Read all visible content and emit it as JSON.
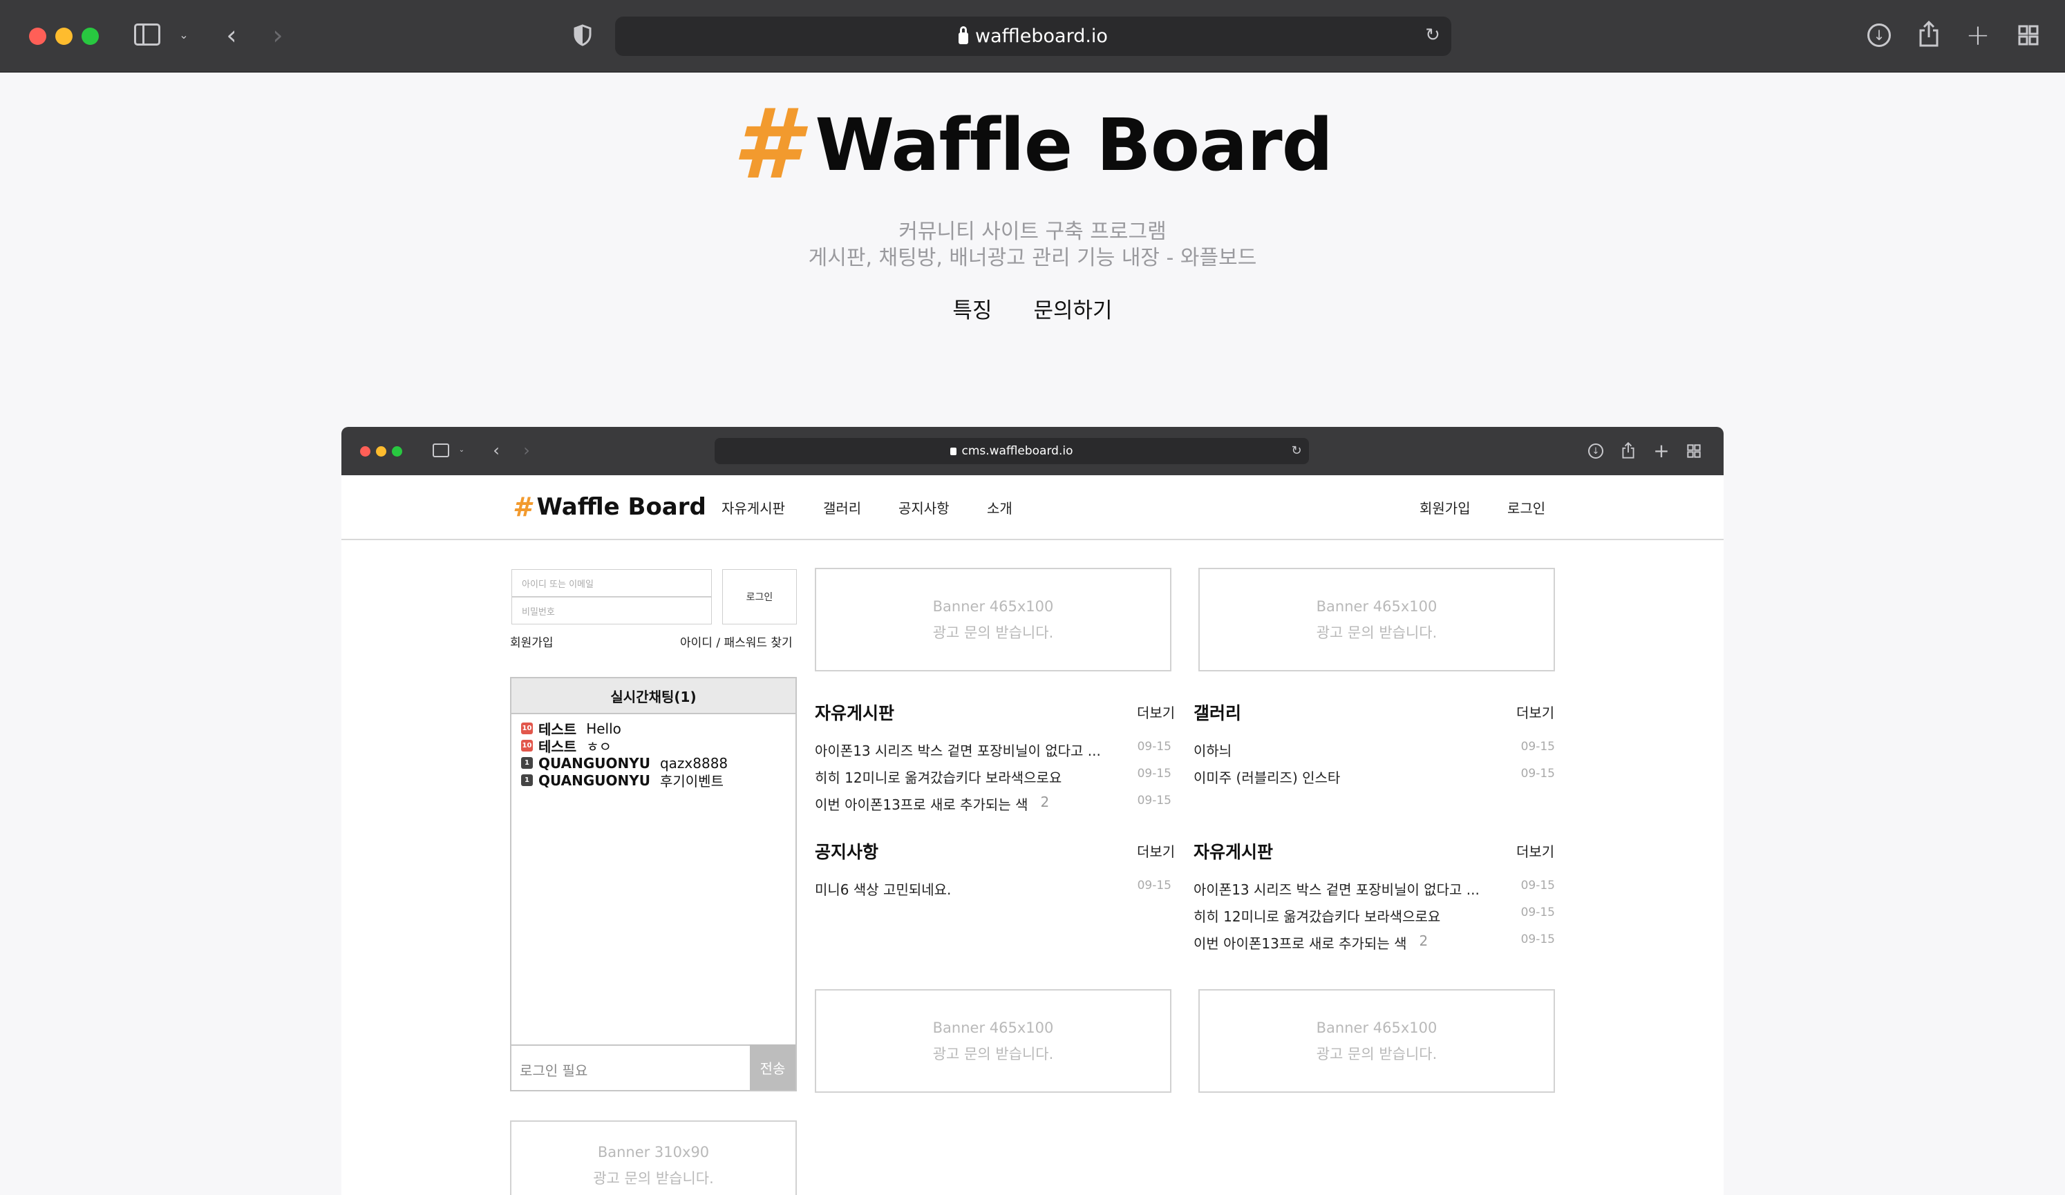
{
  "browser": {
    "url": "waffleboard.io",
    "colors": {
      "close": "#ff5f57",
      "minimize": "#febc2e",
      "zoom": "#28c840"
    }
  },
  "hero": {
    "logo_mark": "#",
    "title": "Waffle Board",
    "subtitle_line1": "커뮤니티 사이트 구축 프로그램",
    "subtitle_line2": "게시판, 채팅방, 배너광고 관리 기능 내장 - 와플보드",
    "nav": [
      "특징",
      "문의하기"
    ],
    "brand_color": "#f29a2e"
  },
  "inner_browser": {
    "url": "cms.waffleboard.io"
  },
  "site": {
    "logo_mark": "#",
    "title": "Waffle Board",
    "nav": [
      "자유게시판",
      "갤러리",
      "공지사항",
      "소개"
    ],
    "auth": [
      "회원가입",
      "로그인"
    ]
  },
  "login": {
    "id_placeholder": "아이디 또는 이메일",
    "pw_placeholder": "비밀번호",
    "button": "로그인",
    "signup": "회원가입",
    "find": "아이디 / 패스워드 찾기"
  },
  "chat": {
    "title": "실시간채팅(1)",
    "messages": [
      {
        "level": "10",
        "name": "테스트",
        "text": "Hello",
        "badge_color": "#e2574c"
      },
      {
        "level": "10",
        "name": "테스트",
        "text": "ㅎㅇ",
        "badge_color": "#e2574c"
      },
      {
        "level": "1",
        "name": "QUANGUONYU",
        "text": "qazx8888",
        "badge_color": "#444444"
      },
      {
        "level": "1",
        "name": "QUANGUONYU",
        "text": "후기이벤트",
        "badge_color": "#444444"
      }
    ],
    "input_placeholder": "로그인 필요",
    "send": "전송"
  },
  "banners": {
    "large_size": "Banner 465x100",
    "small_size": "Banner 310x90",
    "message": "광고 문의 받습니다."
  },
  "boards": [
    {
      "title": "자유게시판",
      "more": "더보기",
      "rows": [
        {
          "title": "아이폰13 시리즈 박스 겉면 포장비닐이 없다고 ...",
          "comments": "",
          "date": "09-15"
        },
        {
          "title": "히히 12미니로 옮겨갔습키다 보라색으로요",
          "comments": "",
          "date": "09-15"
        },
        {
          "title": "이번 아이폰13프로 새로 추가되는 색",
          "comments": "2",
          "date": "09-15"
        }
      ]
    },
    {
      "title": "갤러리",
      "more": "더보기",
      "rows": [
        {
          "title": "이하늬",
          "comments": "",
          "date": "09-15"
        },
        {
          "title": "이미주 (러블리즈) 인스타",
          "comments": "",
          "date": "09-15"
        }
      ]
    },
    {
      "title": "공지사항",
      "more": "더보기",
      "rows": [
        {
          "title": "미니6 색상 고민되네요.",
          "comments": "",
          "date": "09-15"
        }
      ]
    },
    {
      "title": "자유게시판",
      "more": "더보기",
      "rows": [
        {
          "title": "아이폰13 시리즈 박스 겉면 포장비닐이 없다고 ...",
          "comments": "",
          "date": "09-15"
        },
        {
          "title": "히히 12미니로 옮겨갔습키다 보라색으로요",
          "comments": "",
          "date": "09-15"
        },
        {
          "title": "이번 아이폰13프로 새로 추가되는 색",
          "comments": "2",
          "date": "09-15"
        }
      ]
    }
  ]
}
